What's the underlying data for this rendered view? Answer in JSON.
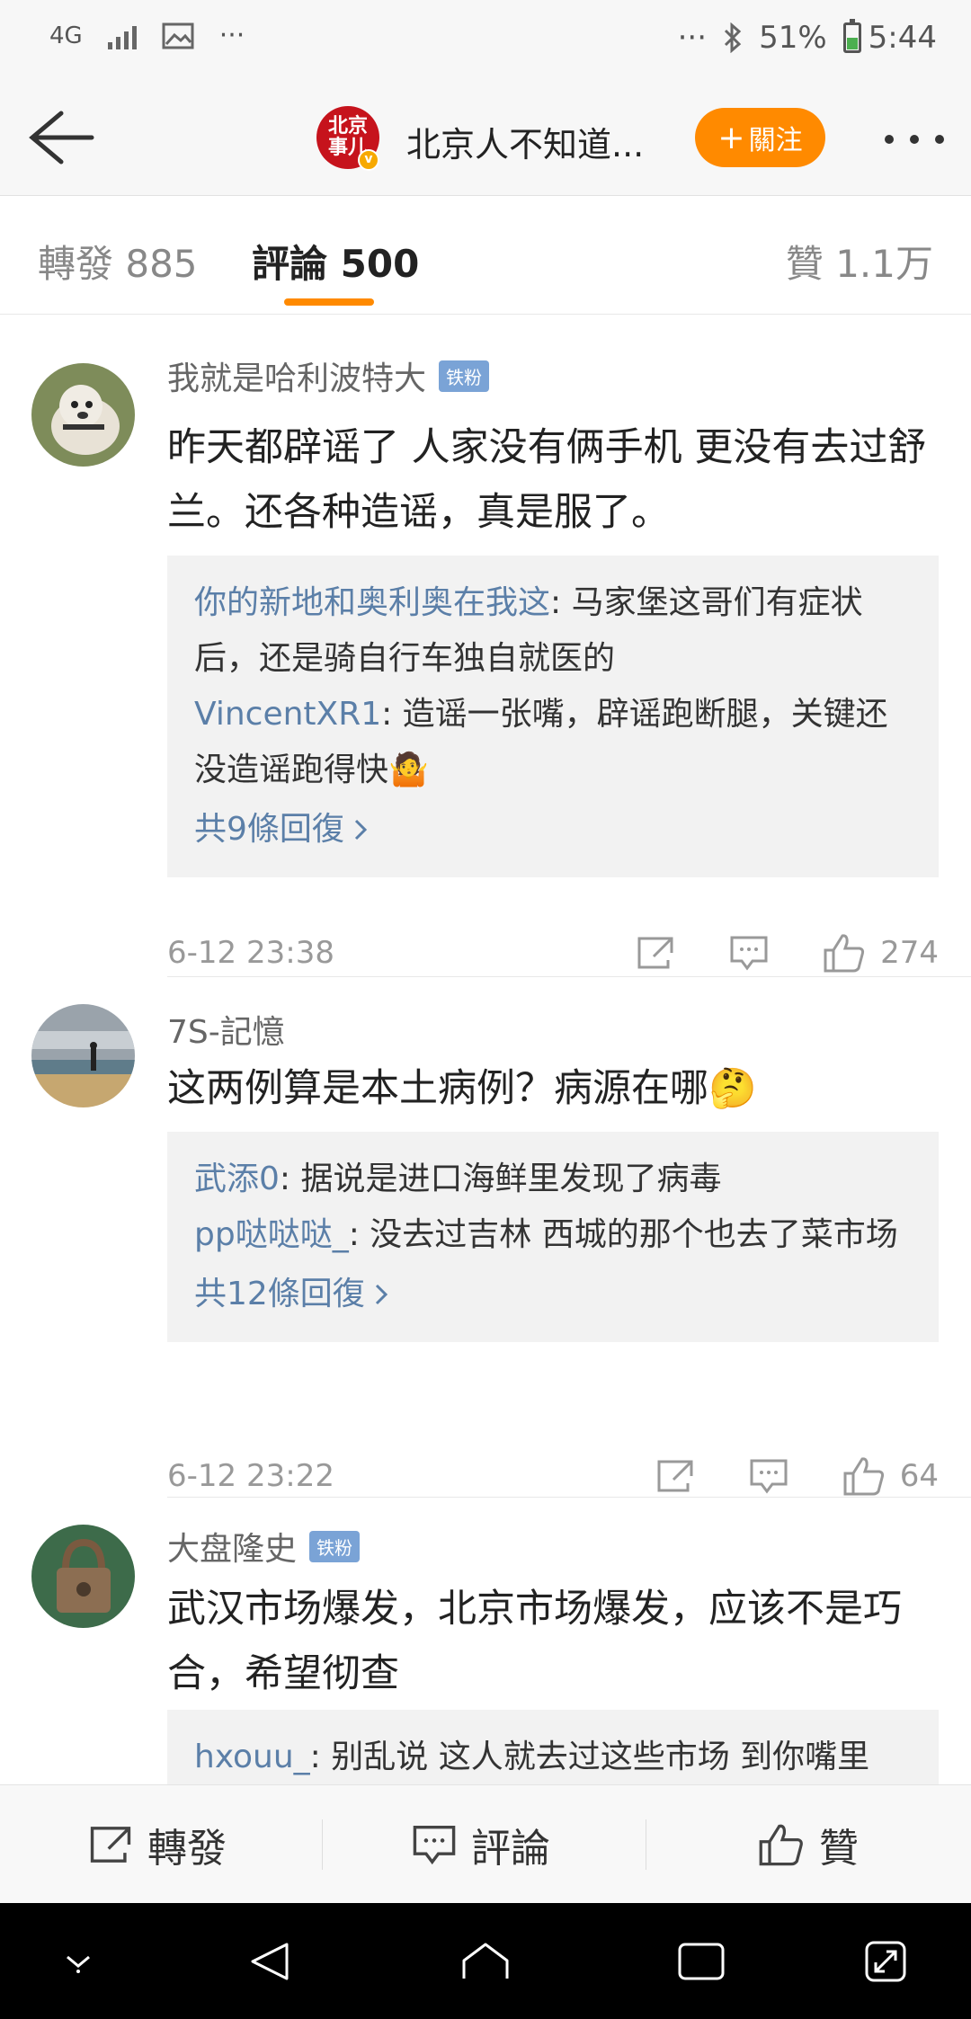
{
  "status": {
    "network": "4G",
    "overflow": "···",
    "battery": "51%",
    "time": "5:44",
    "bluetooth_icon": "bluetooth-icon"
  },
  "nav": {
    "avatar_text_top": "北京",
    "avatar_text_bottom": "事儿",
    "verified_mark": "v",
    "title": "北京人不知道...",
    "follow_label": "關注",
    "follow_plus": "+"
  },
  "tabs": [
    {
      "label": "轉發 885"
    },
    {
      "label": "評論 500",
      "active": true
    },
    {
      "label": "贊 1.1万"
    }
  ],
  "comments": [
    {
      "user": "我就是哈利波特大",
      "badge": "铁粉",
      "text": "昨天都辟谣了 人家没有俩手机 更没有去过舒兰。还各种造谣，真是服了。",
      "replies": [
        {
          "user": "你的新地和奥利奥在我这",
          "text": ": 马家堡这哥们有症状后，还是骑自行车独自就医的"
        },
        {
          "user": "VincentXR1",
          "text": ": 造谣一张嘴，辟谣跑断腿，关键还没造谣跑得快🤷"
        }
      ],
      "more_replies": "共9條回復",
      "time": "6-12 23:38",
      "likes": "274"
    },
    {
      "user": "7S-記憶",
      "text": "这两例算是本土病例？病源在哪🤔",
      "replies": [
        {
          "user": "武添0",
          "text": ": 据说是进口海鲜里发现了病毒"
        },
        {
          "user": "pp哒哒哒_",
          "text": ": 没去过吉林 西城的那个也去了菜市场"
        }
      ],
      "more_replies": "共12條回復",
      "time": "6-12 23:22",
      "likes": "64"
    },
    {
      "user": "大盘隆史",
      "badge": "铁粉",
      "text": "武汉市场爆发，北京市场爆发，应该不是巧合，希望彻查",
      "replies": [
        {
          "user": "hxouu_",
          "text": ": 别乱说 这人就去过这些市场 到你嘴里"
        }
      ]
    }
  ],
  "bottom": {
    "repost": "轉發",
    "comment": "評論",
    "like": "贊"
  },
  "colors": {
    "accent": "#ff8a00",
    "link": "#5b7fa8",
    "fan_badge": "#7aa3d6"
  }
}
